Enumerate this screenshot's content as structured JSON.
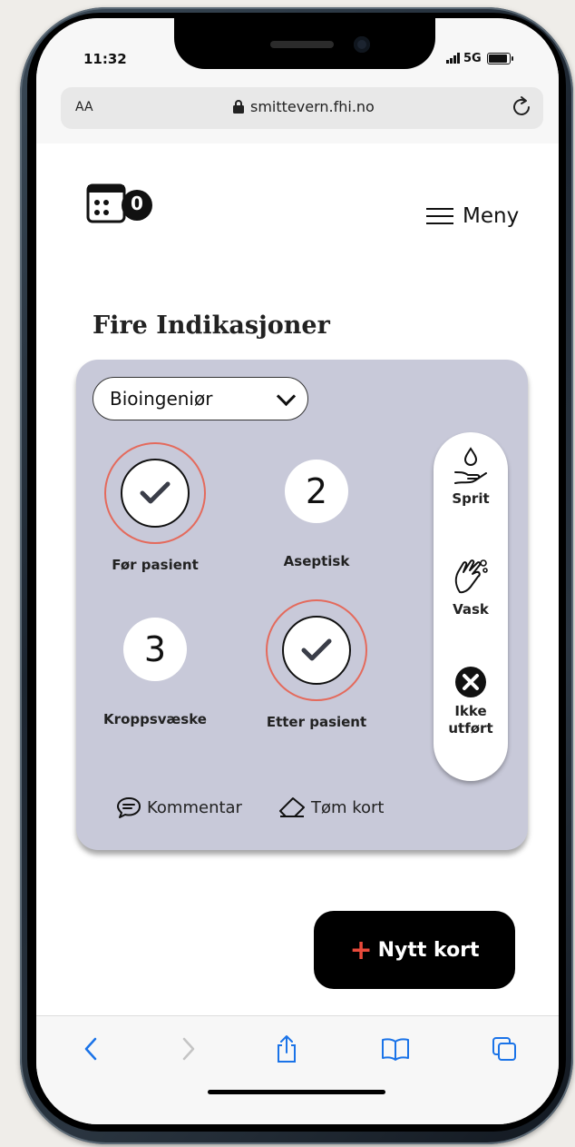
{
  "status": {
    "time": "11:32",
    "network": "5G"
  },
  "browser": {
    "text_size": "AA",
    "url": "smittevern.fhi.no"
  },
  "header": {
    "counter": "0",
    "menu_label": "Meny"
  },
  "page": {
    "title": "Fire Indikasjoner"
  },
  "card": {
    "role_select": "Bioingeniør",
    "indications": [
      {
        "label": "Før pasient",
        "state": "checked",
        "number": ""
      },
      {
        "label": "Aseptisk",
        "state": "number",
        "number": "2"
      },
      {
        "label": "Kroppsvæske",
        "state": "number",
        "number": "3"
      },
      {
        "label": "Etter pasient",
        "state": "checked",
        "number": ""
      }
    ],
    "actions": [
      {
        "label": "Sprit",
        "icon": "hand-sanitizer-icon"
      },
      {
        "label": "Vask",
        "icon": "hand-wash-icon"
      },
      {
        "label": "Ikke utført",
        "icon": "x-circle-icon"
      }
    ],
    "comment_label": "Kommentar",
    "clear_label": "Tøm kort"
  },
  "new_card": {
    "plus": "+",
    "label": "Nytt kort"
  },
  "colors": {
    "card_bg": "#c8c9d9",
    "accent_red": "#e84a3b",
    "ring": "#e46a5c"
  }
}
